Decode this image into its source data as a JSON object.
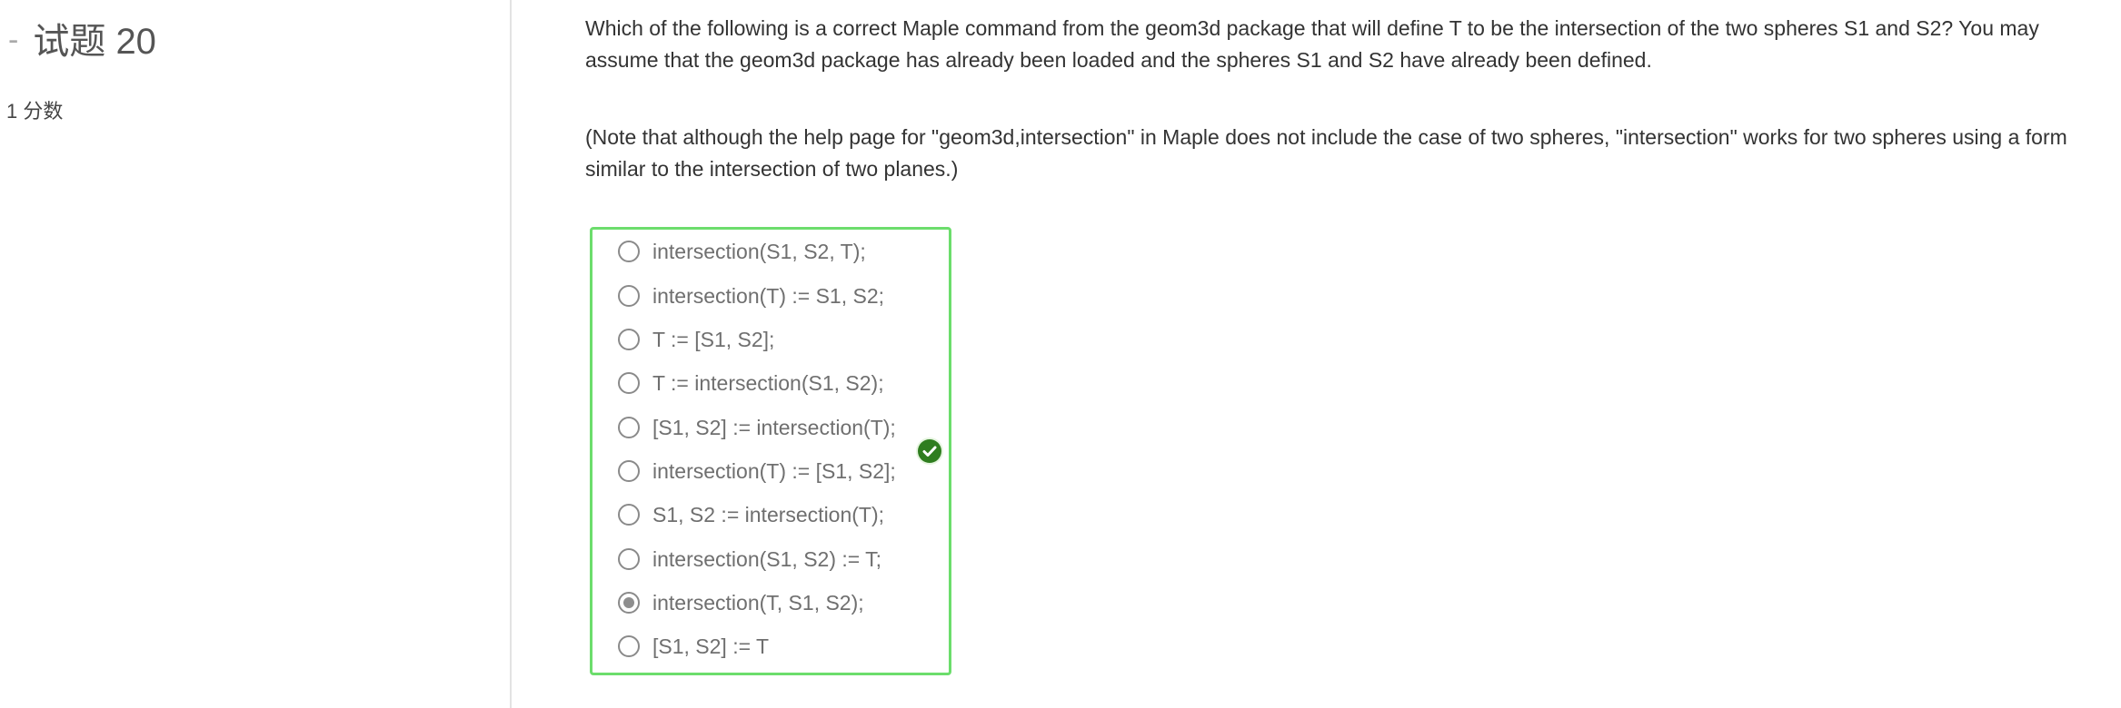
{
  "sidebar": {
    "dash": "-",
    "question_title": "试题 20",
    "points": "1 分数"
  },
  "question": {
    "text": "Which of the following is a correct Maple command from the geom3d package that will define T to be the intersection of the two spheres S1 and S2?  You may assume that the geom3d package has already been loaded and the spheres S1 and S2 have already been defined.",
    "note": "(Note that although the help page for \"geom3d,intersection\" in Maple does not include the case of two spheres,  \"intersection\" works for two spheres using a form similar to the intersection of two planes.)"
  },
  "options": [
    {
      "label": "intersection(S1, S2, T);",
      "selected": false
    },
    {
      "label": "intersection(T) := S1, S2;",
      "selected": false
    },
    {
      "label": "T := [S1, S2];",
      "selected": false
    },
    {
      "label": "T := intersection(S1, S2);",
      "selected": false
    },
    {
      "label": "[S1, S2] := intersection(T);",
      "selected": false
    },
    {
      "label": "intersection(T) := [S1, S2];",
      "selected": false
    },
    {
      "label": "S1, S2 := intersection(T);",
      "selected": false
    },
    {
      "label": "intersection(S1, S2) := T;",
      "selected": false
    },
    {
      "label": "intersection(T, S1, S2);",
      "selected": true
    },
    {
      "label": "[S1, S2] := T",
      "selected": false
    }
  ],
  "result": {
    "icon": "check-circle-icon",
    "color": "#2f7d1f",
    "border_color": "#6cdd6c"
  }
}
